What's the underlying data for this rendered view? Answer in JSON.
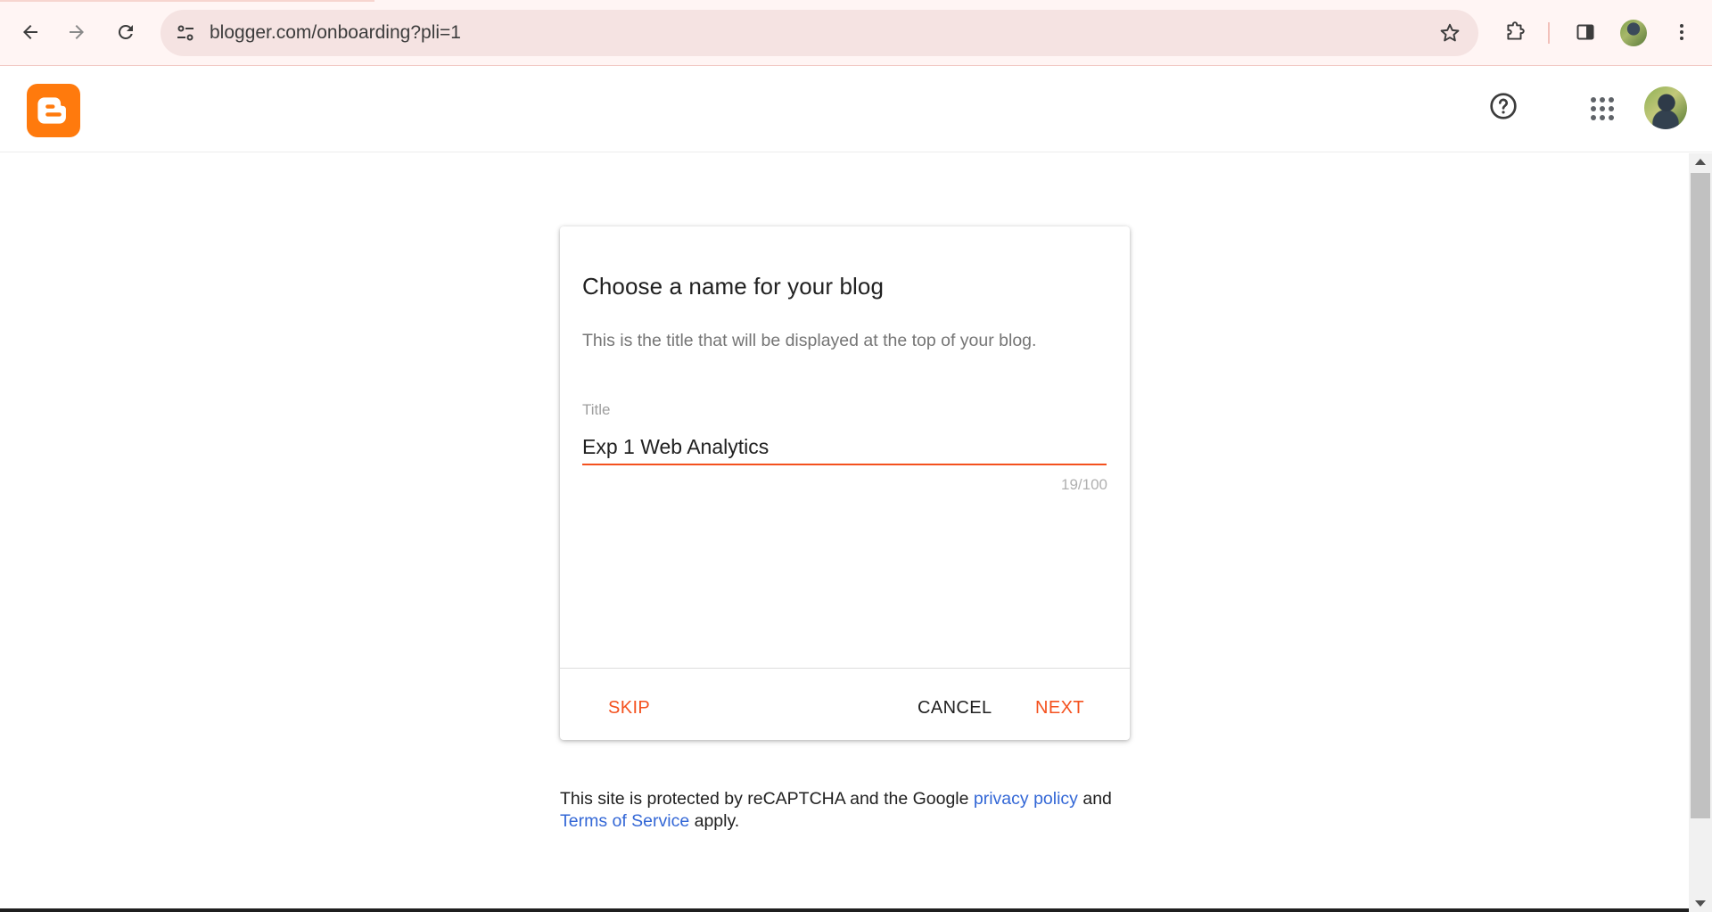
{
  "browser": {
    "url": "blogger.com/onboarding?pli=1",
    "icons": [
      "back-arrow-icon",
      "forward-arrow-icon",
      "reload-icon",
      "site-settings-icon",
      "bookmark-star-icon",
      "extensions-icon",
      "side-panel-icon",
      "kebab-menu-icon"
    ]
  },
  "header": {
    "logo": "blogger-logo",
    "icons": [
      "help-icon",
      "google-apps-icon"
    ],
    "accent_color": "#ff7a0d"
  },
  "dialog": {
    "title": "Choose a name for your blog",
    "description": "This is the title that will be displayed at the top of your blog.",
    "field": {
      "label": "Title",
      "value": "Exp 1 Web Analytics",
      "char_count": "19/100"
    },
    "buttons": {
      "skip": "SKIP",
      "cancel": "CANCEL",
      "next": "NEXT"
    },
    "accent_color": "#f4511e"
  },
  "footer": {
    "text_before": "This site is protected by reCAPTCHA and the Google ",
    "privacy_link": "privacy policy",
    "text_middle": " and",
    "terms_link": "Terms of Service",
    "text_after": " apply.",
    "link_color": "#3367d6"
  }
}
